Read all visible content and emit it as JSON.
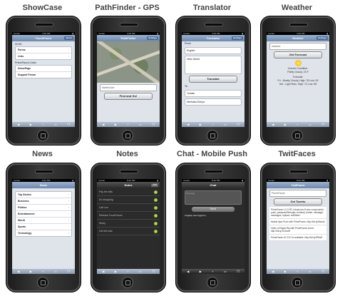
{
  "apps": [
    {
      "caption": "ShowCase",
      "nav_title": "TouchFaces",
      "nav_right": "About",
      "group1": "UI Kit",
      "group1_items": [
        "Forms",
        "Lists"
      ],
      "group2": "PrimeFaces Links",
      "group2_items": [
        "HomePage",
        "Support Forum"
      ]
    },
    {
      "caption": "PathFinder - GPS",
      "nav_title": "PathFinder",
      "nav_right": "Settings",
      "input_value": "Market Ave",
      "button": "Find and Go!"
    },
    {
      "caption": "Translator",
      "nav_title": "Translator",
      "nav_right": "Settings",
      "from_label": "From",
      "from_lang": "English",
      "from_text": "Hello World",
      "button": "Translate",
      "to_label": "To",
      "to_lang": "Turkish",
      "to_text": "Merhaba Dünya"
    },
    {
      "caption": "Weather",
      "nav_title": "Weather",
      "nav_right": "Settings",
      "input_value": "Istanbul",
      "button": "Get Forecast",
      "condition_title": "Current Condition:",
      "condition": "Partly Cloudy, 15 F",
      "forecast_title": "Forecast:",
      "forecast_lines": [
        "Fri - Mostly Cloudy, High: 78 Low: 52",
        "Sat - Light Rain, High: 72 Low: 56"
      ]
    },
    {
      "caption": "News",
      "nav_title": "News",
      "items": [
        "Top Stories",
        "Business",
        "Politics",
        "Entertainment",
        "World",
        "Sports",
        "Technology"
      ]
    },
    {
      "caption": "Notes",
      "nav_title": "Notes",
      "nav_right": "Add",
      "items": [
        "Pay the bills",
        "Do shopping",
        "Call Leo",
        "Release TouchFaces",
        "Study",
        "Get the kids"
      ]
    },
    {
      "caption": "Chat - Mobile Push",
      "nav_title": "Chat",
      "placeholder": "Message",
      "button": "Send",
      "message": "Cagatay has logged in."
    },
    {
      "caption": "TwitFaces",
      "nav_title": "TwitFaces",
      "input_value": "PrimeFaces",
      "button": "Get Tweets",
      "tweets": [
        "PrimeFaces 1.0.0.RC introduces 8 new components; push, passwordStrength, terminal, printer, message, messages, inplace, tabSlider.",
        "Mobile Ajax Push with PrimeFaces: http://bit.ly/Mwx4z",
        "Video of Rapid Ria with PrimeFaces event: http://bit.ly/1G1kaR",
        "PrimeFaces UI 0.9.3 is available, http://bit.ly/3R6c8"
      ]
    }
  ],
  "status_bar": {
    "carrier": "Carrier",
    "time": "3:36 PM",
    "time_alt": "8:42 PM"
  }
}
